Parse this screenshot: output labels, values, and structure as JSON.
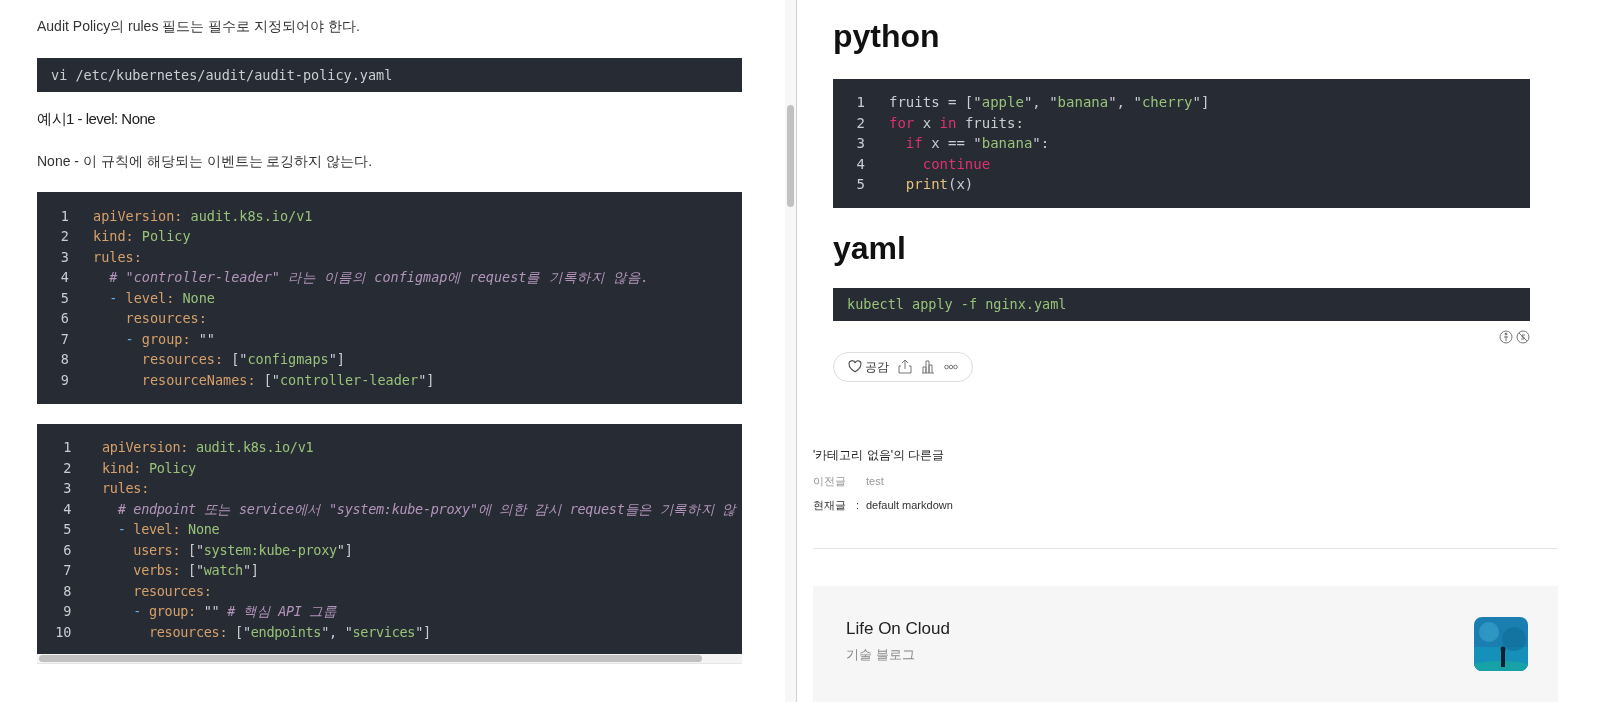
{
  "left": {
    "intro": "Audit Policy의 rules 필드는 필수로 지정되어야 한다.",
    "command": "vi /etc/kubernetes/audit/audit-policy.yaml",
    "example_title": "예시1 - level: None",
    "description": "None - 이 규칙에 해당되는 이벤트는 로깅하지 않는다.",
    "code_blocks": [
      {
        "lines": [
          {
            "number": "1",
            "tokens": [
              {
                "kind": "key",
                "text": "apiVersion:"
              },
              {
                "kind": "str",
                "text": " audit.k8s.io/v1"
              }
            ]
          },
          {
            "number": "2",
            "tokens": [
              {
                "kind": "key",
                "text": "kind:"
              },
              {
                "kind": "str",
                "text": " Policy"
              }
            ]
          },
          {
            "number": "3",
            "tokens": [
              {
                "kind": "key",
                "text": "rules:"
              }
            ]
          },
          {
            "number": "4",
            "tokens": [
              {
                "kind": "comment",
                "text": "  # \"controller-leader\" 라는 이름의 configmap에 request를 기록하지 않음."
              }
            ]
          },
          {
            "number": "5",
            "tokens": [
              {
                "kind": "dash",
                "text": "  -"
              },
              {
                "kind": "key",
                "text": " level:"
              },
              {
                "kind": "str",
                "text": " None"
              }
            ]
          },
          {
            "number": "6",
            "tokens": [
              {
                "kind": "key",
                "text": "    resources:"
              }
            ]
          },
          {
            "number": "7",
            "tokens": [
              {
                "kind": "dash",
                "text": "    -"
              },
              {
                "kind": "key",
                "text": " group:"
              },
              {
                "kind": "plain",
                "text": " \"\""
              }
            ]
          },
          {
            "number": "8",
            "tokens": [
              {
                "kind": "key",
                "text": "      resources:"
              },
              {
                "kind": "plain",
                "text": " [\""
              },
              {
                "kind": "str",
                "text": "configmaps"
              },
              {
                "kind": "plain",
                "text": "\"]"
              }
            ]
          },
          {
            "number": "9",
            "tokens": [
              {
                "kind": "key",
                "text": "      resourceNames:"
              },
              {
                "kind": "plain",
                "text": " [\""
              },
              {
                "kind": "str",
                "text": "controller-leader"
              },
              {
                "kind": "plain",
                "text": "\"]"
              }
            ]
          }
        ]
      },
      {
        "lines": [
          {
            "number": "1",
            "tokens": [
              {
                "kind": "key",
                "text": "apiVersion:"
              },
              {
                "kind": "str",
                "text": " audit.k8s.io/v1"
              }
            ]
          },
          {
            "number": "2",
            "tokens": [
              {
                "kind": "key",
                "text": "kind:"
              },
              {
                "kind": "str",
                "text": " Policy"
              }
            ]
          },
          {
            "number": "3",
            "tokens": [
              {
                "kind": "key",
                "text": "rules:"
              }
            ]
          },
          {
            "number": "4",
            "tokens": [
              {
                "kind": "comment",
                "text": "  # endpoint 또는 service에서 \"system:kube-proxy\"에 의한 감시 request들은 기록하지 않"
              }
            ]
          },
          {
            "number": "5",
            "tokens": [
              {
                "kind": "dash",
                "text": "  -"
              },
              {
                "kind": "key",
                "text": " level:"
              },
              {
                "kind": "str",
                "text": " None"
              }
            ]
          },
          {
            "number": "6",
            "tokens": [
              {
                "kind": "key",
                "text": "    users:"
              },
              {
                "kind": "plain",
                "text": " [\""
              },
              {
                "kind": "str",
                "text": "system:kube-proxy"
              },
              {
                "kind": "plain",
                "text": "\"]"
              }
            ]
          },
          {
            "number": "7",
            "tokens": [
              {
                "kind": "key",
                "text": "    verbs:"
              },
              {
                "kind": "plain",
                "text": " [\""
              },
              {
                "kind": "str",
                "text": "watch"
              },
              {
                "kind": "plain",
                "text": "\"]"
              }
            ]
          },
          {
            "number": "8",
            "tokens": [
              {
                "kind": "key",
                "text": "    resources:"
              }
            ]
          },
          {
            "number": "9",
            "tokens": [
              {
                "kind": "dash",
                "text": "    -"
              },
              {
                "kind": "key",
                "text": " group:"
              },
              {
                "kind": "plain",
                "text": " \"\" "
              },
              {
                "kind": "comment",
                "text": "# 핵심 API 그룹"
              }
            ]
          },
          {
            "number": "10",
            "tokens": [
              {
                "kind": "key",
                "text": "      resources:"
              },
              {
                "kind": "plain",
                "text": " [\""
              },
              {
                "kind": "str",
                "text": "endpoints"
              },
              {
                "kind": "plain",
                "text": "\", \""
              },
              {
                "kind": "str",
                "text": "services"
              },
              {
                "kind": "plain",
                "text": "\"]"
              }
            ]
          }
        ]
      }
    ]
  },
  "right": {
    "sections": [
      {
        "heading": "python",
        "lines": [
          {
            "number": "1",
            "tokens": [
              {
                "kind": "plain",
                "text": "fruits = [\""
              },
              {
                "kind": "str",
                "text": "apple"
              },
              {
                "kind": "plain",
                "text": "\", \""
              },
              {
                "kind": "str",
                "text": "banana"
              },
              {
                "kind": "plain",
                "text": "\", \""
              },
              {
                "kind": "str",
                "text": "cherry"
              },
              {
                "kind": "plain",
                "text": "\"]"
              }
            ]
          },
          {
            "number": "2",
            "tokens": [
              {
                "kind": "kw",
                "text": "for"
              },
              {
                "kind": "plain",
                "text": " x "
              },
              {
                "kind": "kw",
                "text": "in"
              },
              {
                "kind": "plain",
                "text": " fruits:"
              }
            ]
          },
          {
            "number": "3",
            "tokens": [
              {
                "kind": "kw",
                "text": "  if"
              },
              {
                "kind": "plain",
                "text": " x == \""
              },
              {
                "kind": "str",
                "text": "banana"
              },
              {
                "kind": "plain",
                "text": "\":"
              }
            ]
          },
          {
            "number": "4",
            "tokens": [
              {
                "kind": "kw",
                "text": "    continue"
              }
            ]
          },
          {
            "number": "5",
            "tokens": [
              {
                "kind": "fn",
                "text": "  print"
              },
              {
                "kind": "plain",
                "text": "(x)"
              }
            ]
          }
        ]
      },
      {
        "heading": "yaml",
        "command": "kubectl apply -f nginx.yaml"
      }
    ],
    "reaction": {
      "like_label": "공감"
    },
    "related": {
      "title": "'카테고리 없음'의 다른글",
      "items": [
        {
          "label": "이전글",
          "title": "test",
          "selected": false
        },
        {
          "label": "현재글",
          "separator": ":",
          "title": "default markdown",
          "selected": true
        }
      ]
    },
    "blog": {
      "name": "Life On Cloud",
      "subtitle": "기술 블로그"
    }
  }
}
